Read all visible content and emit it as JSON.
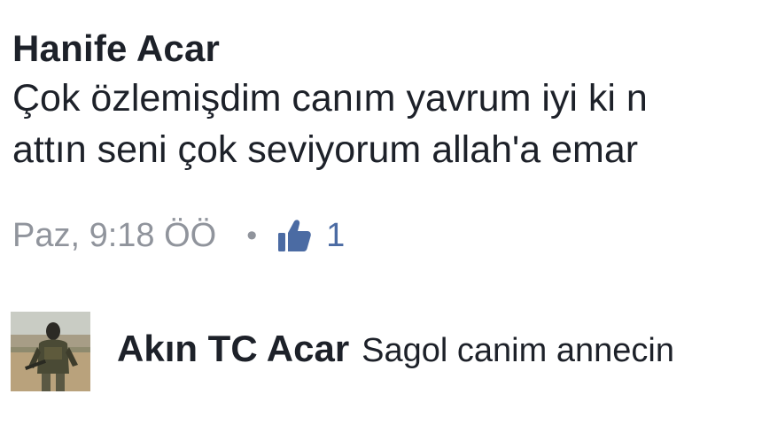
{
  "comment": {
    "author": "Hanife Acar",
    "lines": [
      "Çok özlemişdim canım yavrum iyi ki n",
      "attın seni çok seviyorum allah'a emar"
    ],
    "timestamp": "Paz, 9:18 ÖÖ",
    "separator": "•",
    "like_icon": "thumbs-up-icon",
    "like_count": "1"
  },
  "reply": {
    "avatar": "profile-photo",
    "author": "Akın TC Acar",
    "text": "Sagol canim annecin"
  },
  "colors": {
    "text": "#1d2129",
    "meta": "#90949c",
    "like_accent": "#4b6ba3"
  }
}
